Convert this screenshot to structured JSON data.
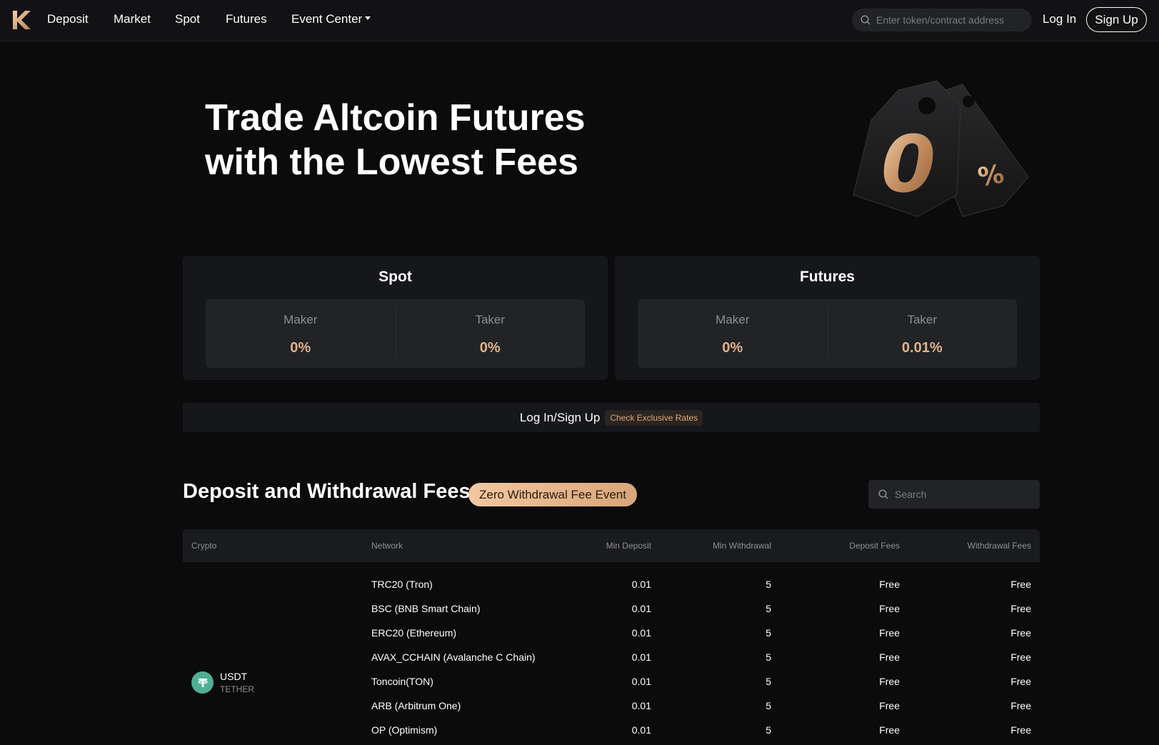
{
  "nav": {
    "items": [
      "Deposit",
      "Market",
      "Spot",
      "Futures"
    ],
    "event_center": "Event Center",
    "search_placeholder": "Enter token/contract address",
    "login": "Log In",
    "signup": "Sign Up"
  },
  "hero": {
    "title_line1": "Trade Altcoin Futures",
    "title_line2": "with the Lowest Fees",
    "art_text": "0",
    "art_percent": "%"
  },
  "fees": {
    "spot": {
      "title": "Spot",
      "maker_label": "Maker",
      "maker_value": "0%",
      "taker_label": "Taker",
      "taker_value": "0%"
    },
    "futures": {
      "title": "Futures",
      "maker_label": "Maker",
      "maker_value": "0%",
      "taker_label": "Taker",
      "taker_value": "0.01%"
    }
  },
  "login_banner": {
    "text": "Log In/Sign Up",
    "badge": "Check Exclusive Rates"
  },
  "deposit_section": {
    "title": "Deposit and Withdrawal Fees",
    "event_badge": "Zero Withdrawal Fee Event",
    "search_placeholder": "Search"
  },
  "table": {
    "headers": [
      "Crypto",
      "Network",
      "Min Deposit",
      "Min Withdrawal",
      "Deposit Fees",
      "Withdrawal Fees"
    ],
    "coin": {
      "symbol": "USDT",
      "name": "TETHER",
      "icon": "tether-icon",
      "color": "#50af95"
    },
    "rows": [
      {
        "network": "TRC20 (Tron)",
        "min_deposit": "0.01",
        "min_withdrawal": "5",
        "deposit_fee": "Free",
        "withdrawal_fee": "Free"
      },
      {
        "network": "BSC (BNB Smart Chain)",
        "min_deposit": "0.01",
        "min_withdrawal": "5",
        "deposit_fee": "Free",
        "withdrawal_fee": "Free"
      },
      {
        "network": "ERC20 (Ethereum)",
        "min_deposit": "0.01",
        "min_withdrawal": "5",
        "deposit_fee": "Free",
        "withdrawal_fee": "Free"
      },
      {
        "network": "AVAX_CCHAIN (Avalanche C Chain)",
        "min_deposit": "0.01",
        "min_withdrawal": "5",
        "deposit_fee": "Free",
        "withdrawal_fee": "Free"
      },
      {
        "network": "Toncoin(TON)",
        "min_deposit": "0.01",
        "min_withdrawal": "5",
        "deposit_fee": "Free",
        "withdrawal_fee": "Free"
      },
      {
        "network": "ARB (Arbitrum One)",
        "min_deposit": "0.01",
        "min_withdrawal": "5",
        "deposit_fee": "Free",
        "withdrawal_fee": "Free"
      },
      {
        "network": "OP (Optimism)",
        "min_deposit": "0.01",
        "min_withdrawal": "5",
        "deposit_fee": "Free",
        "withdrawal_fee": "Free"
      }
    ]
  },
  "colors": {
    "accent": "#e0b288",
    "background": "#0b0b0c",
    "card": "#16171a"
  }
}
